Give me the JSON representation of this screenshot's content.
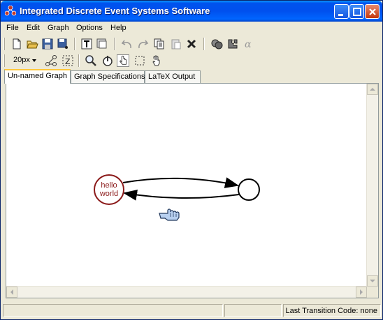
{
  "window": {
    "title": "Integrated Discrete Event Systems Software",
    "accent": "#0055ea"
  },
  "menu": [
    "File",
    "Edit",
    "Graph",
    "Options",
    "Help"
  ],
  "toolbar": {
    "row1_icons": [
      "new-file-icon",
      "open-folder-icon",
      "save-icon",
      "save-as-icon",
      "text-tool-icon",
      "copy-as-icon",
      "undo-icon",
      "redo-icon",
      "copy-icon",
      "paste-icon",
      "delete-icon",
      "compute-icon",
      "puzzle-icon",
      "alpha-icon"
    ],
    "zoom_value": "20px",
    "row2_icons": [
      "graph-layout-icon",
      "tree-layout-icon",
      "zoom-tool-icon",
      "move-tool-icon",
      "hand-tool-icon",
      "select-tool-icon",
      "grab-tool-icon"
    ]
  },
  "tabs": [
    "Un-named Graph",
    "Graph Specifications",
    "LaTeX Output"
  ],
  "graph": {
    "nodes": [
      {
        "id": "hello-world",
        "label_line1": "hello",
        "label_line2": "world",
        "color": "#8b1a1a",
        "initial": true
      },
      {
        "id": "state-2",
        "label_line1": "",
        "label_line2": "",
        "color": "#000000",
        "initial": false
      }
    ],
    "edges": [
      {
        "from": "hello-world",
        "to": "state-2"
      },
      {
        "from": "state-2",
        "to": "hello-world"
      }
    ]
  },
  "status": {
    "text": "Last Transition Code:  none"
  }
}
